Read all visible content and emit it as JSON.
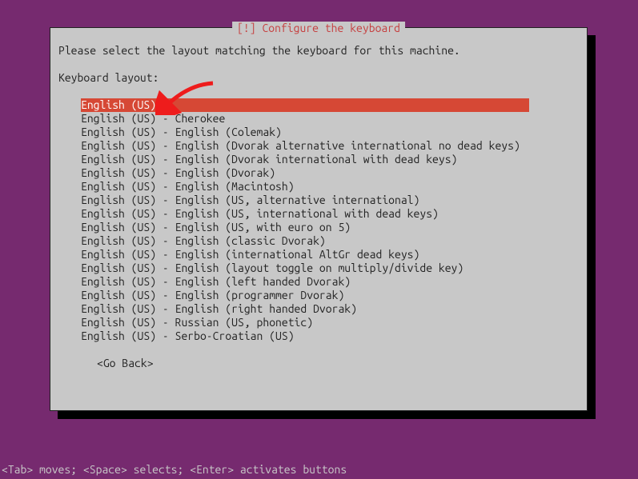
{
  "dialog": {
    "title_prefix": "[!]",
    "title": "Configure the keyboard",
    "prompt": "Please select the layout matching the keyboard for this machine.",
    "label": "Keyboard layout:",
    "go_back": "<Go Back>"
  },
  "layouts": [
    "English (US)",
    "English (US) - Cherokee",
    "English (US) - English (Colemak)",
    "English (US) - English (Dvorak alternative international no dead keys)",
    "English (US) - English (Dvorak international with dead keys)",
    "English (US) - English (Dvorak)",
    "English (US) - English (Macintosh)",
    "English (US) - English (US, alternative international)",
    "English (US) - English (US, international with dead keys)",
    "English (US) - English (US, with euro on 5)",
    "English (US) - English (classic Dvorak)",
    "English (US) - English (international AltGr dead keys)",
    "English (US) - English (layout toggle on multiply/divide key)",
    "English (US) - English (left handed Dvorak)",
    "English (US) - English (programmer Dvorak)",
    "English (US) - English (right handed Dvorak)",
    "English (US) - Russian (US, phonetic)",
    "English (US) - Serbo-Croatian (US)"
  ],
  "selected_index": 0,
  "statusbar": "<Tab> moves; <Space> selects; <Enter> activates buttons",
  "annotation": {
    "arrow_color": "#ee1c1c"
  }
}
